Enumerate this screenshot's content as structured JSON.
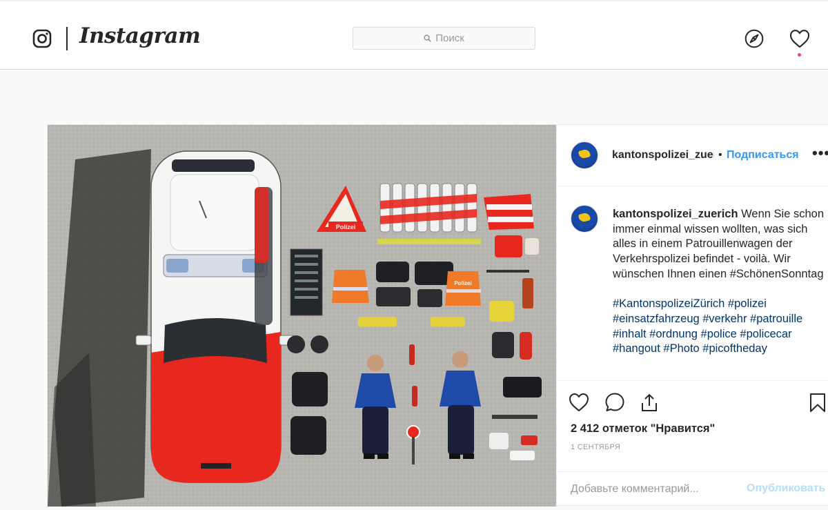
{
  "nav": {
    "logo_text": "Instagram",
    "search_placeholder": "Поиск",
    "icons": [
      "instagram-camera-icon",
      "search-icon",
      "explore-compass-icon",
      "activity-heart-icon"
    ]
  },
  "post": {
    "username_header": "kantonspolizei_zuerich",
    "dot": "•",
    "follow_label": "Подписаться",
    "more_label": "•••",
    "caption": {
      "username": "kantonspolizei_zuerich",
      "text": "Wenn Sie schon immer einmal wissen wollten, was sich alles in einem Patrouillenwagen der Verkehrspolizei befindet - voilà. Wir wünschen Ihnen einen #SchönenSonntag",
      "hashtags": "#KantonspolizeiZürich #polizei #einsatzfahrzeug #verkehr #patrouille #inhalt #ordnung #police #policecar #hangout #Photo #picoftheday"
    },
    "photo_labels": {
      "sign": "Polizei",
      "vest_left": "Polizei",
      "vest_right": "Polizei"
    },
    "likes": "2 412 отметок \"Нравится\"",
    "date": "1 сентября",
    "comment_placeholder": "Добавьте комментарий...",
    "publish_label": "Опубликовать"
  },
  "colors": {
    "accent": "#3897f0",
    "notification": "#ed4956",
    "police_red": "#e8281e"
  }
}
